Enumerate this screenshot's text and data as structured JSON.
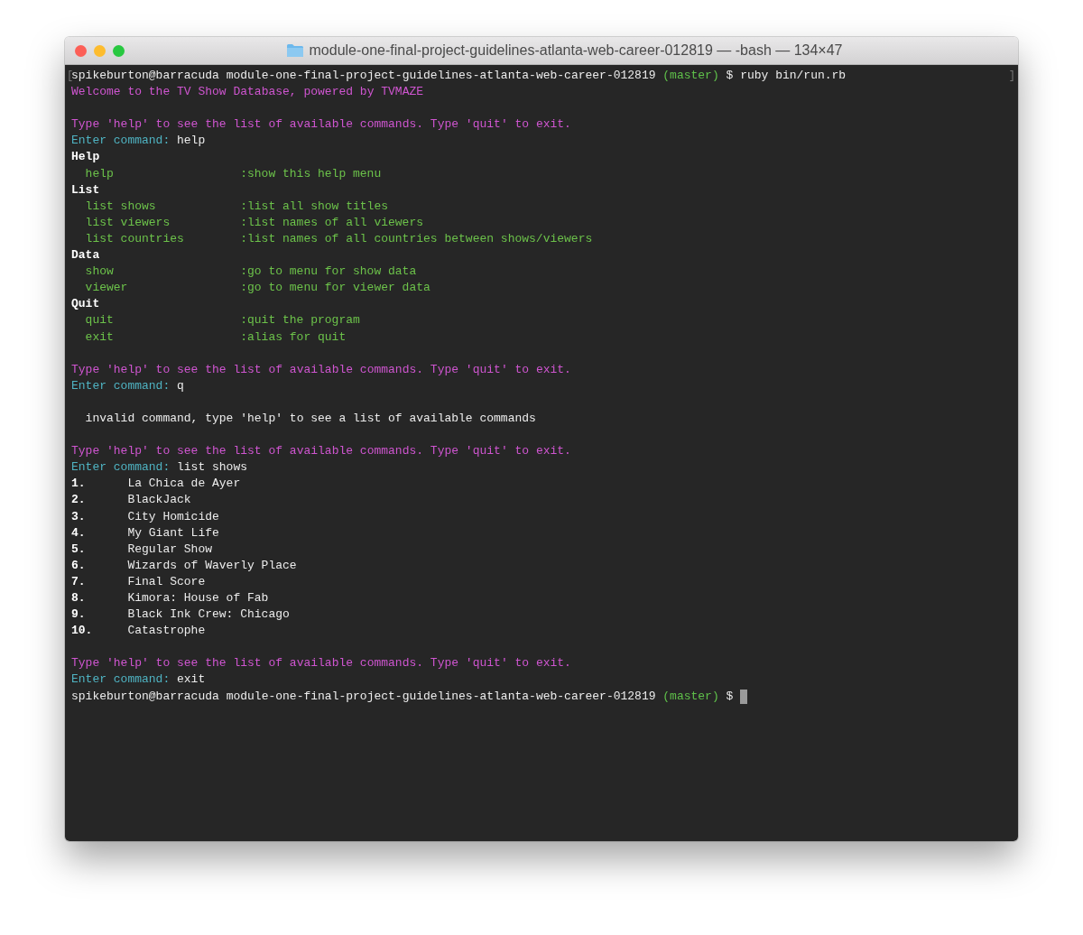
{
  "window": {
    "title": "module-one-final-project-guidelines-atlanta-web-career-012819 — -bash — 134×47"
  },
  "terminal": {
    "mark_left": "[",
    "mark_right": "]",
    "lines": [
      {
        "kind": "prompt",
        "user_host": "spikeburton@barracuda",
        "path": "module-one-final-project-guidelines-atlanta-web-career-012819",
        "branch": "(master)",
        "symbol": "$",
        "command": "ruby bin/run.rb"
      },
      {
        "kind": "message",
        "text": "Welcome to the TV Show Database, powered by TVMAZE"
      },
      {
        "kind": "blank"
      },
      {
        "kind": "message",
        "text": "Type 'help' to see the list of available commands. Type 'quit' to exit."
      },
      {
        "kind": "input",
        "label": "Enter command:",
        "value": "help"
      },
      {
        "kind": "heading",
        "text": "Help"
      },
      {
        "kind": "help-row",
        "command": "help",
        "description": ":show this help menu"
      },
      {
        "kind": "heading",
        "text": "List"
      },
      {
        "kind": "help-row",
        "command": "list shows",
        "description": ":list all show titles"
      },
      {
        "kind": "help-row",
        "command": "list viewers",
        "description": ":list names of all viewers"
      },
      {
        "kind": "help-row",
        "command": "list countries",
        "description": ":list names of all countries between shows/viewers"
      },
      {
        "kind": "heading",
        "text": "Data"
      },
      {
        "kind": "help-row",
        "command": "show",
        "description": ":go to menu for show data"
      },
      {
        "kind": "help-row",
        "command": "viewer",
        "description": ":go to menu for viewer data"
      },
      {
        "kind": "heading",
        "text": "Quit"
      },
      {
        "kind": "help-row",
        "command": "quit",
        "description": ":quit the program"
      },
      {
        "kind": "help-row",
        "command": "exit",
        "description": ":alias for quit"
      },
      {
        "kind": "blank"
      },
      {
        "kind": "message",
        "text": "Type 'help' to see the list of available commands. Type 'quit' to exit."
      },
      {
        "kind": "input",
        "label": "Enter command:",
        "value": "q"
      },
      {
        "kind": "blank"
      },
      {
        "kind": "notice",
        "text": "invalid command, type 'help' to see a list of available commands"
      },
      {
        "kind": "blank"
      },
      {
        "kind": "message",
        "text": "Type 'help' to see the list of available commands. Type 'quit' to exit."
      },
      {
        "kind": "input",
        "label": "Enter command:",
        "value": "list shows"
      },
      {
        "kind": "list-row",
        "number": "1.",
        "title": "La Chica de Ayer"
      },
      {
        "kind": "list-row",
        "number": "2.",
        "title": "BlackJack"
      },
      {
        "kind": "list-row",
        "number": "3.",
        "title": "City Homicide"
      },
      {
        "kind": "list-row",
        "number": "4.",
        "title": "My Giant Life"
      },
      {
        "kind": "list-row",
        "number": "5.",
        "title": "Regular Show"
      },
      {
        "kind": "list-row",
        "number": "6.",
        "title": "Wizards of Waverly Place"
      },
      {
        "kind": "list-row",
        "number": "7.",
        "title": "Final Score"
      },
      {
        "kind": "list-row",
        "number": "8.",
        "title": "Kimora: House of Fab"
      },
      {
        "kind": "list-row",
        "number": "9.",
        "title": "Black Ink Crew: Chicago"
      },
      {
        "kind": "list-row",
        "number": "10.",
        "title": "Catastrophe"
      },
      {
        "kind": "blank"
      },
      {
        "kind": "message",
        "text": "Type 'help' to see the list of available commands. Type 'quit' to exit."
      },
      {
        "kind": "input",
        "label": "Enter command:",
        "value": "exit"
      },
      {
        "kind": "prompt",
        "user_host": "spikeburton@barracuda",
        "path": "module-one-final-project-guidelines-atlanta-web-career-012819",
        "branch": "(master)",
        "symbol": "$",
        "cursor": true
      }
    ]
  }
}
